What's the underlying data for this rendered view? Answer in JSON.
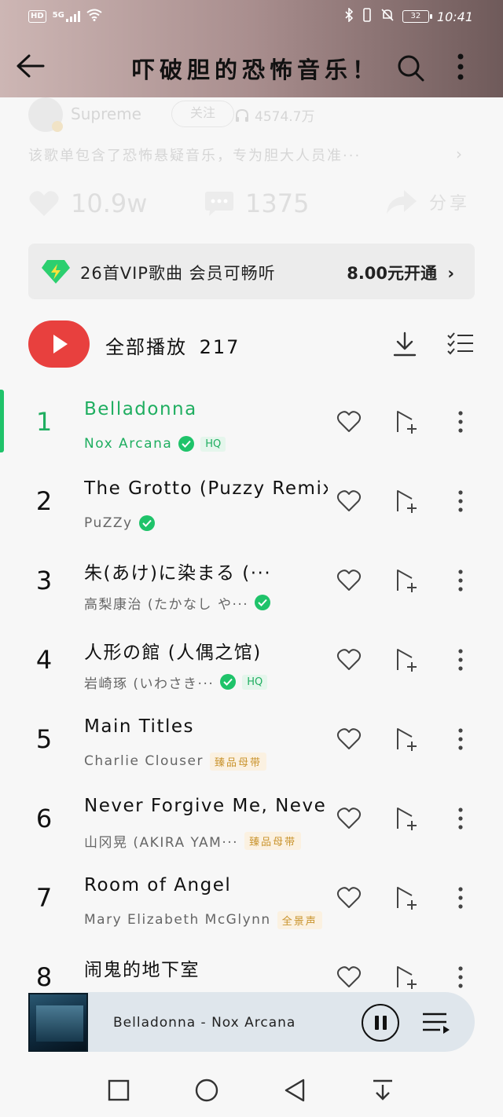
{
  "status_bar": {
    "hd": "HD",
    "signal": "5G",
    "battery": "32",
    "time": "10:41"
  },
  "header": {
    "title": "吓破胆的恐怖音乐！"
  },
  "owner": {
    "name": "Supreme",
    "follow_label": "关注",
    "plays": "4574.7万"
  },
  "description": "该歌单包含了恐怖悬疑音乐，专为胆大人员准···",
  "actions": {
    "likes": "10.9w",
    "comments": "1375",
    "share_label": "分享"
  },
  "vip_bar": {
    "text": "26首VIP歌曲 会员可畅听",
    "price": "8.00元开通"
  },
  "play_all": {
    "label": "全部播放",
    "count": "217"
  },
  "songs": [
    {
      "index": "1",
      "title": "Belladonna",
      "artist": "Nox Arcana",
      "verified": true,
      "tag": "HQ",
      "tag_type": "hq",
      "active": true
    },
    {
      "index": "2",
      "title": "The Grotto (Puzzy Remix)",
      "artist": "PuZZy",
      "verified": true,
      "tag": "",
      "tag_type": ""
    },
    {
      "index": "3",
      "title": "朱(あけ)に染まる (···",
      "artist": "高梨康治 (たかなし や···",
      "verified": true,
      "tag": "",
      "tag_type": ""
    },
    {
      "index": "4",
      "title": "人形の館 (人偶之馆)",
      "artist": "岩崎琢 (いわさき···",
      "verified": true,
      "tag": "HQ",
      "tag_type": "hq"
    },
    {
      "index": "5",
      "title": "Main Titles",
      "artist": "Charlie Clouser",
      "verified": false,
      "tag": "臻品母带",
      "tag_type": "gold"
    },
    {
      "index": "6",
      "title": "Never Forgive Me, Neve···",
      "artist": "山冈晃 (AKIRA YAM···",
      "verified": false,
      "tag": "臻品母带",
      "tag_type": "gold"
    },
    {
      "index": "7",
      "title": "Room of Angel",
      "artist": "Mary Elizabeth McGlynn",
      "verified": false,
      "tag": "全景声",
      "tag_type": "gold"
    },
    {
      "index": "8",
      "title": "闹鬼的地下室",
      "artist": "",
      "verified": false,
      "tag": "",
      "tag_type": ""
    }
  ],
  "mini_player": {
    "now_playing": "Belladonna - Nox Arcana"
  },
  "colors": {
    "accent_green": "#1fc36a",
    "play_red": "#e8403e",
    "vip_bg": "#ececec",
    "player_bg": "#dfe6ec"
  }
}
